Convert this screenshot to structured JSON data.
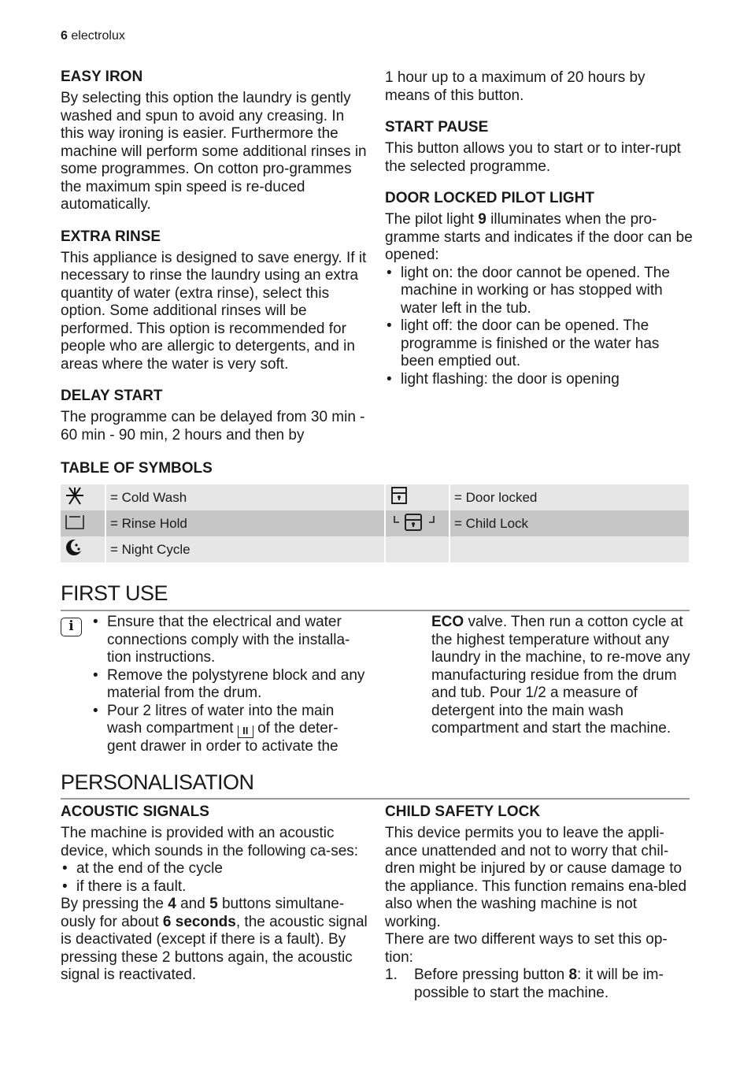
{
  "header": {
    "page_number": "6",
    "brand": "electrolux"
  },
  "left_top": {
    "easy_iron": {
      "title": "EASY IRON",
      "text": "By selecting this option the laundry is gently washed and spun to avoid any creasing. In this way ironing is easier. Furthermore the machine will perform some additional rinses in some programmes. On cotton pro-grammes the maximum spin speed is re-duced automatically."
    },
    "extra_rinse": {
      "title": "EXTRA RINSE",
      "text": "This appliance is designed to save energy. If it necessary to rinse the laundry using an extra quantity of water (extra rinse), select this option. Some additional rinses will be performed. This option is recommended for people who are allergic to detergents, and in areas where the water is very soft."
    },
    "delay_start": {
      "title": "DELAY START",
      "text": "The programme can be delayed from 30 min - 60 min - 90 min, 2 hours and then by"
    }
  },
  "right_top": {
    "delay_continued": "1 hour up to a maximum of 20 hours by means of this button.",
    "start_pause": {
      "title": "START PAUSE",
      "text": "This button allows you to start or to inter-rupt the selected programme."
    },
    "door_locked": {
      "title": "DOOR LOCKED PILOT LIGHT",
      "intro_before": "The pilot light ",
      "intro_bold": "9",
      "intro_after": " illuminates when the pro-gramme starts and indicates if the door can be opened:",
      "bullets": [
        "light on: the door cannot be opened. The machine in working or has stopped with water left in the tub.",
        "light off: the door can be opened. The programme is finished or the water has been emptied out.",
        "light flashing: the door is opening"
      ]
    }
  },
  "symbols": {
    "title": "TABLE OF SYMBOLS",
    "rows": [
      {
        "icon1": "cold-wash-icon",
        "label1": "= Cold Wash",
        "icon2": "door-locked-icon",
        "label2": "= Door locked"
      },
      {
        "icon1": "rinse-hold-icon",
        "label1": "= Rinse Hold",
        "icon2": "child-lock-icon",
        "label2": "= Child Lock"
      },
      {
        "icon1": "night-cycle-icon",
        "label1": "= Night Cycle",
        "icon2": "",
        "label2": ""
      }
    ]
  },
  "first_use": {
    "title": "FIRST USE",
    "info_icon": "info-icon",
    "info_glyph": "i",
    "bullets": [
      "Ensure that the electrical and water connections comply with the installa-tion instructions.",
      "Remove the polystyrene block and any material from the drum."
    ],
    "bullet3_before": "Pour 2 litres of water into the main wash compartment ",
    "bullet3_icon": "II",
    "bullet3_after": " of the deter-gent drawer in order to activate the",
    "right_bold": "ECO",
    "right_text": " valve. Then run a cotton cycle at the highest temperature without any laundry in the machine, to re-move any manufacturing residue from the drum and tub. Pour 1/2 a measure of detergent into the main wash compartment and start the machine."
  },
  "personalisation": {
    "title": "PERSONALISATION",
    "acoustic": {
      "title": "ACOUSTIC SIGNALS",
      "intro": "The machine is provided with an acoustic device, which sounds in the following ca-ses:",
      "bullets": [
        "at the end of the cycle",
        "if there is a fault."
      ],
      "p_1": "By pressing the ",
      "b_1": "4",
      "p_2": " and ",
      "b_2": "5",
      "p_3": " buttons simultane-ously for about ",
      "b_3": "6 seconds",
      "p_4": ", the acoustic signal is deactivated (except if there is a fault). By pressing these 2 buttons again, the acoustic signal is reactivated."
    },
    "child_lock": {
      "title": "CHILD SAFETY LOCK",
      "intro": "This device permits you to leave the appli-ance unattended and not to worry that chil-dren might be injured by or cause damage to the appliance. This function remains ena-bled also when the washing machine is not working.",
      "ways": "There are two different ways to set this op-tion:",
      "steps": [
        {
          "num": "1.",
          "before": "Before pressing button ",
          "bold": "8",
          "after": ": it will be im-possible to start the machine."
        }
      ]
    }
  }
}
